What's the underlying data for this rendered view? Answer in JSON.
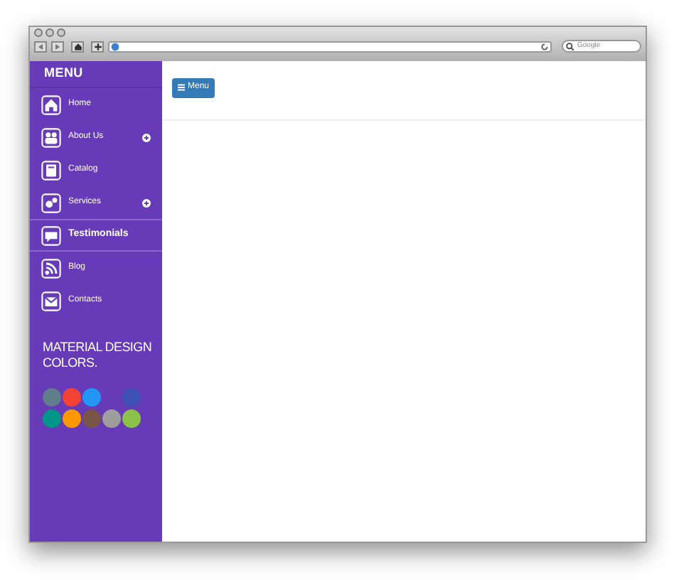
{
  "browser": {
    "search": {
      "placeholder": "Google"
    }
  },
  "sidebar": {
    "title": "MENU",
    "items": [
      {
        "label": "Home",
        "kind": "home",
        "selected": false,
        "expandable": false
      },
      {
        "label": "About Us",
        "kind": "people",
        "selected": false,
        "expandable": true
      },
      {
        "label": "Catalog",
        "kind": "book",
        "selected": false,
        "expandable": false
      },
      {
        "label": "Services",
        "kind": "gear",
        "selected": false,
        "expandable": true
      },
      {
        "label": "Testimonials",
        "kind": "chat",
        "selected": true,
        "expandable": false
      },
      {
        "label": "Blog",
        "kind": "rss",
        "selected": false,
        "expandable": false
      },
      {
        "label": "Contacts",
        "kind": "mail",
        "selected": false,
        "expandable": false
      }
    ],
    "colors_title": "MATERIAL DESIGN COLORS.",
    "swatches": [
      {
        "kind": "swatch",
        "color": "#607d8b"
      },
      {
        "kind": "swatch",
        "color": "#f44336"
      },
      {
        "kind": "swatch",
        "color": "#2196f3"
      },
      {
        "kind": "empty"
      },
      {
        "kind": "swatch",
        "color": "#3f51b5"
      },
      {
        "kind": "swatch",
        "color": "#009688"
      },
      {
        "kind": "swatch",
        "color": "#ff9800"
      },
      {
        "kind": "swatch",
        "color": "#795548"
      },
      {
        "kind": "swatch",
        "color": "#9e9e9e"
      },
      {
        "kind": "swatch",
        "color": "#8bc34a"
      }
    ]
  },
  "content": {
    "menu_button": "Menu"
  }
}
